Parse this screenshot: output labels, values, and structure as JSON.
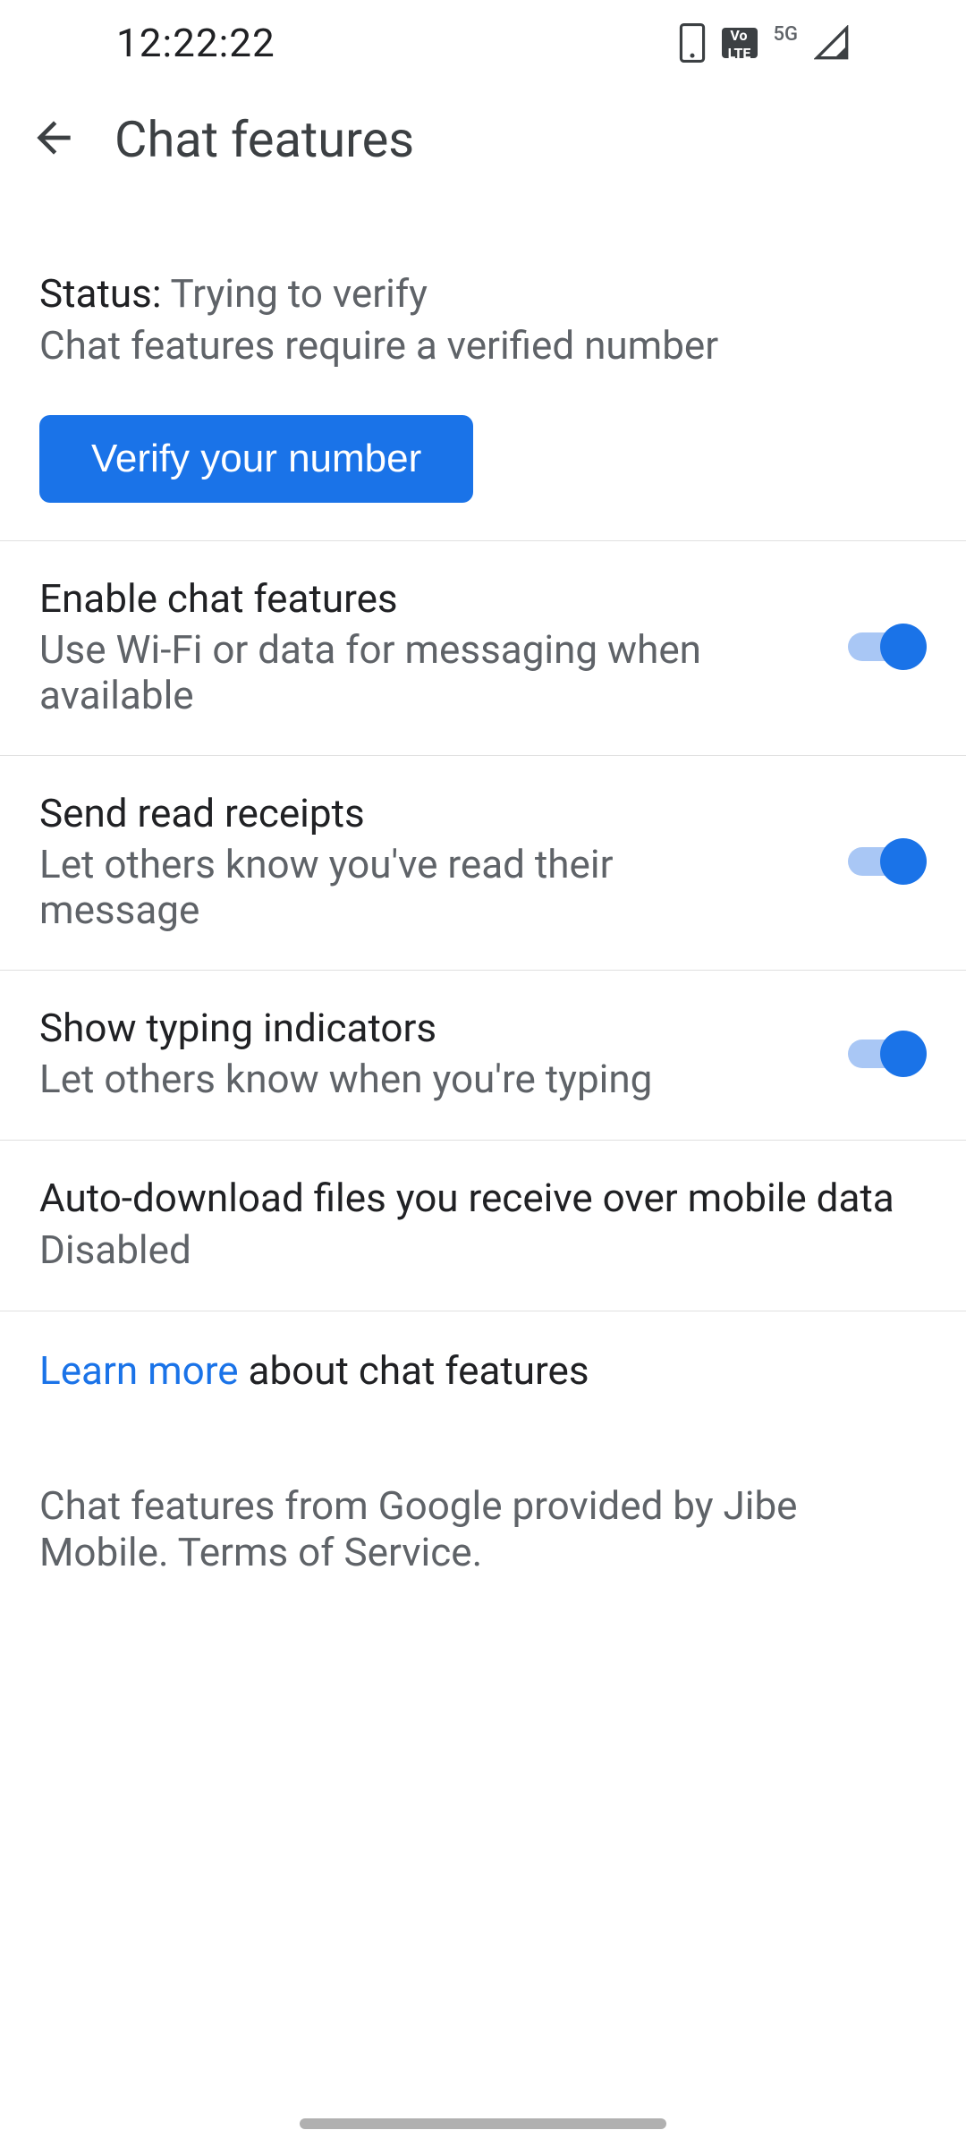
{
  "statusbar": {
    "time": "12:22:22",
    "network_label": "5G"
  },
  "appbar": {
    "title": "Chat features"
  },
  "status": {
    "label": "Status: ",
    "value": "Trying to verify",
    "subtitle": "Chat features require a verified number",
    "verify_button": "Verify your number"
  },
  "settings": [
    {
      "title": "Enable chat features",
      "subtitle": "Use Wi-Fi or data for messaging when available",
      "on": true
    },
    {
      "title": "Send read receipts",
      "subtitle": "Let others know you've read their message",
      "on": true
    },
    {
      "title": "Show typing indicators",
      "subtitle": "Let others know when you're typing",
      "on": true
    }
  ],
  "auto_download": {
    "title": "Auto-download files you receive over mobile data",
    "value": "Disabled"
  },
  "learn_more": {
    "link": "Learn more",
    "rest": " about chat features"
  },
  "provider_notice": "Chat features from Google provided by Jibe Mobile. Terms of Service."
}
